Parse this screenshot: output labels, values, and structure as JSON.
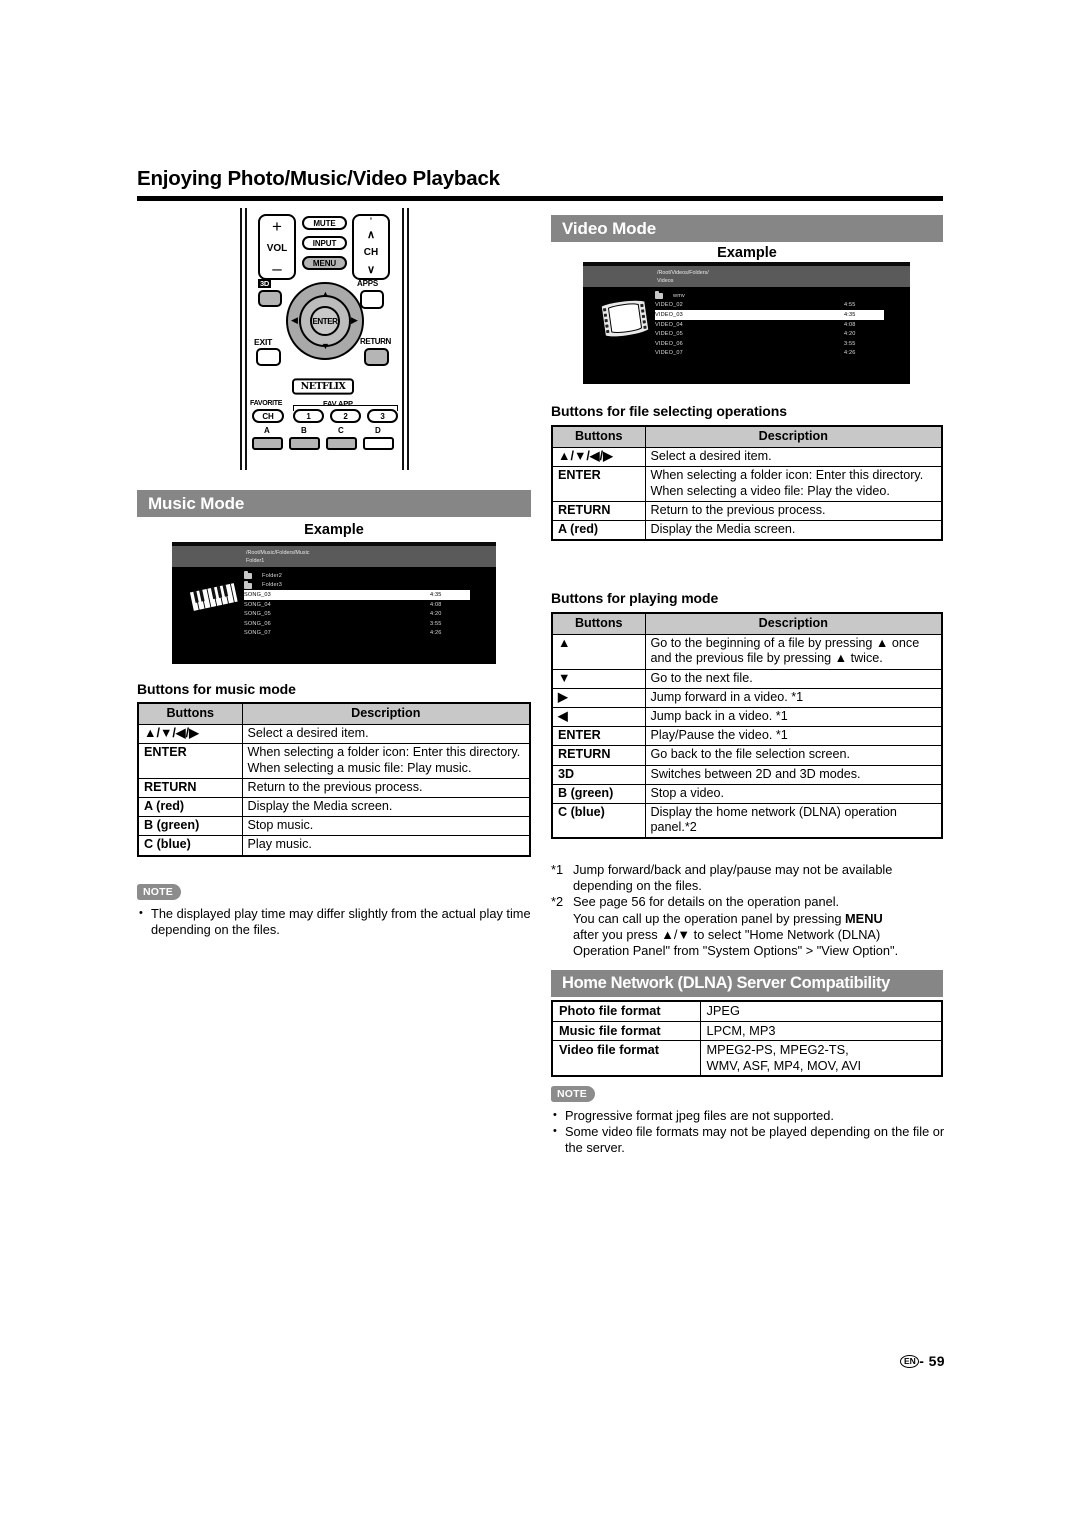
{
  "page": {
    "title": "Enjoying Photo/Music/Video Playback",
    "number": "59",
    "locale_mark": "EN",
    "page_sep": "-"
  },
  "remote": {
    "vol_label": "VOL",
    "vol_plus": "+",
    "vol_minus": "–",
    "ch_label": "CH",
    "ch_up": "∧",
    "ch_dot": "°",
    "ch_down": "∨",
    "mute": "MUTE",
    "input": "INPUT",
    "menu": "MENU",
    "three_d": "3D",
    "apps": "APPS",
    "enter": "ENTER",
    "arrow_up": "▲",
    "arrow_down": "▼",
    "arrow_left": "◀",
    "arrow_right": "▶",
    "exit": "EXIT",
    "return": "RETURN",
    "netflix": "NETFLIX",
    "favorite": "FAVORITE",
    "fav_ch": "CH",
    "fav_app": "FAV APP",
    "fav1": "1",
    "fav2": "2",
    "fav3": "3",
    "color_a": "A",
    "color_b": "B",
    "color_c": "C",
    "color_d": "D"
  },
  "music_mode": {
    "section_title": "Music Mode",
    "example_label": "Example",
    "screen": {
      "path_line1": "/Root/Music/Folders/Music",
      "path_line2": "Folder1",
      "thumb_icon": "piano-keyboard-icon",
      "rows": [
        {
          "name": "Folder2",
          "time": "",
          "folder": true,
          "selected": false
        },
        {
          "name": "Folder3",
          "time": "",
          "folder": true,
          "selected": false
        },
        {
          "name": "SONG_03",
          "time": "4:35",
          "folder": false,
          "selected": true
        },
        {
          "name": "SONG_04",
          "time": "4:08",
          "folder": false,
          "selected": false
        },
        {
          "name": "SONG_05",
          "time": "4:20",
          "folder": false,
          "selected": false
        },
        {
          "name": "SONG_06",
          "time": "3:55",
          "folder": false,
          "selected": false
        },
        {
          "name": "SONG_07",
          "time": "4:26",
          "folder": false,
          "selected": false
        }
      ]
    },
    "table_heading": "Buttons for music mode",
    "table": {
      "headers": [
        "Buttons",
        "Description"
      ],
      "rows": [
        {
          "key": "▲/▼/◀/▶",
          "desc": "Select a desired item."
        },
        {
          "key": "ENTER",
          "desc": "When selecting a folder icon: Enter this directory.\nWhen selecting a music file: Play music."
        },
        {
          "key": "RETURN",
          "desc": "Return to the previous process."
        },
        {
          "key": "A (red)",
          "desc": "Display the Media screen."
        },
        {
          "key": "B (green)",
          "desc": "Stop music."
        },
        {
          "key": "C (blue)",
          "desc": "Play music."
        }
      ]
    },
    "note_badge": "NOTE",
    "notes": [
      "The displayed play time may differ slightly from the actual play time depending on the files."
    ]
  },
  "video_mode": {
    "section_title": "Video Mode",
    "example_label": "Example",
    "screen": {
      "path_line1": "/Root/Videos/Folders/",
      "path_line2": "Videos",
      "thumb_icon": "film-strip-icon",
      "rows": [
        {
          "name": "wmv",
          "time": "",
          "folder": true,
          "selected": false
        },
        {
          "name": "VIDEO_02",
          "time": "4:55",
          "folder": false,
          "selected": false
        },
        {
          "name": "VIDEO_03",
          "time": "4:35",
          "folder": false,
          "selected": true
        },
        {
          "name": "VIDEO_04",
          "time": "4:08",
          "folder": false,
          "selected": false
        },
        {
          "name": "VIDEO_05",
          "time": "4:20",
          "folder": false,
          "selected": false
        },
        {
          "name": "VIDEO_06",
          "time": "3:55",
          "folder": false,
          "selected": false
        },
        {
          "name": "VIDEO_07",
          "time": "4:26",
          "folder": false,
          "selected": false
        }
      ]
    },
    "file_select": {
      "heading": "Buttons for file selecting operations",
      "headers": [
        "Buttons",
        "Description"
      ],
      "rows": [
        {
          "key": "▲/▼/◀/▶",
          "desc": "Select a desired item."
        },
        {
          "key": "ENTER",
          "desc": "When selecting a folder icon: Enter this directory.\nWhen selecting a video file: Play the video."
        },
        {
          "key": "RETURN",
          "desc": "Return to the previous process."
        },
        {
          "key": "A (red)",
          "desc": "Display the Media screen."
        }
      ]
    },
    "playing_mode": {
      "heading": "Buttons for playing mode",
      "headers": [
        "Buttons",
        "Description"
      ],
      "rows": [
        {
          "key": "▲",
          "desc": "Go to the beginning of a file by pressing ▲ once and the previous file by pressing ▲ twice."
        },
        {
          "key": "▼",
          "desc": "Go to the next file."
        },
        {
          "key": "▶",
          "desc": "Jump forward in a video. *1"
        },
        {
          "key": "◀",
          "desc": "Jump back in a video. *1"
        },
        {
          "key": "ENTER",
          "desc": "Play/Pause the video. *1"
        },
        {
          "key": "RETURN",
          "desc": "Go back to the file selection screen."
        },
        {
          "key": "3D",
          "desc": "Switches between 2D and 3D modes."
        },
        {
          "key": "B (green)",
          "desc": "Stop a video."
        },
        {
          "key": "C (blue)",
          "desc": "Display the home network (DLNA) operation panel.*2"
        }
      ]
    },
    "footnotes": {
      "fn1_mark": "*1",
      "fn1_text": "Jump forward/back and play/pause may not be available depending on the files.",
      "fn2_mark": "*2",
      "fn2_line1": "See page 56 for details on the operation panel.",
      "fn2_line2_a": "You can call up the operation panel by pressing ",
      "fn2_line2_b": "MENU",
      "fn2_line3": "after you press ▲/▼ to select \"Home Network (DLNA)",
      "fn2_line4": "Operation Panel\" from \"System Options\" > \"View Option\"."
    }
  },
  "dlna": {
    "section_title": "Home Network (DLNA) Server Compatibility",
    "rows": [
      {
        "key": "Photo file format",
        "value": "JPEG"
      },
      {
        "key": "Music file format",
        "value": "LPCM, MP3"
      },
      {
        "key": "Video file format",
        "value": "MPEG2-PS, MPEG2-TS,\nWMV, ASF, MP4, MOV, AVI"
      }
    ],
    "note_badge": "NOTE",
    "notes": [
      "Progressive format jpeg files are not supported.",
      "Some video file formats may not be played depending on the file or the server."
    ]
  },
  "colors": {
    "section_bar": "#868686",
    "table_header": "#c8c8c8",
    "note_badge": "#8c8c8c",
    "screen_bg": "#000000",
    "screen_pathbar": "#5a5a5a"
  }
}
